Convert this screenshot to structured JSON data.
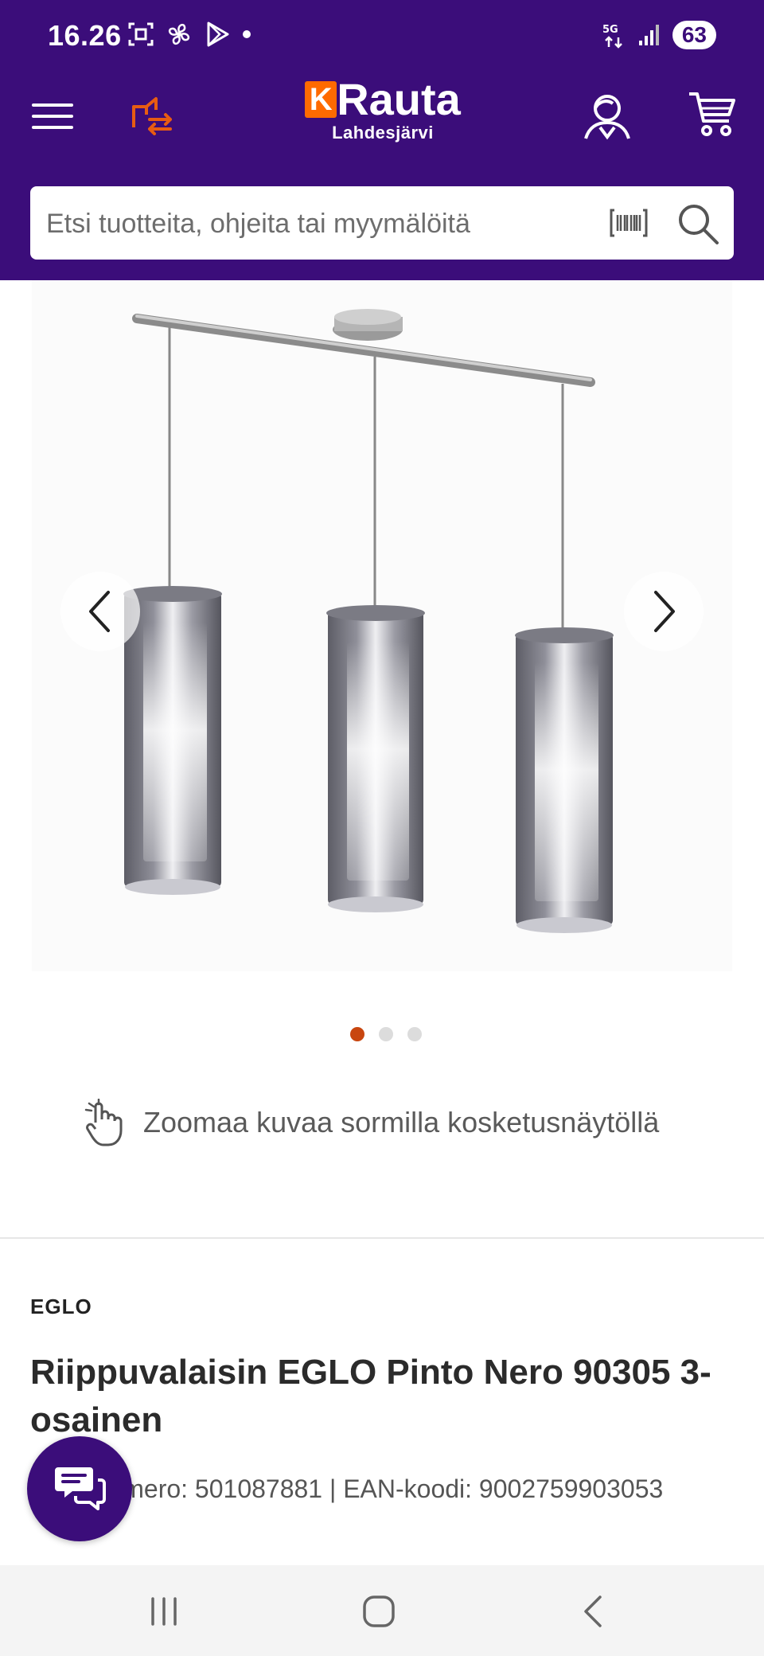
{
  "status_bar": {
    "time": "16.26",
    "network": "5G",
    "battery": "63"
  },
  "header": {
    "logo_letter": "K",
    "logo_word": "Rauta",
    "store_name": "Lahdesjärvi",
    "colors": {
      "background": "#3b0d7a",
      "accent": "#ff6a00"
    }
  },
  "search": {
    "placeholder": "Etsi tuotteita, ohjeita tai myymälöitä"
  },
  "gallery": {
    "image_count": 3,
    "active_index": 1
  },
  "zoom_hint": {
    "text": "Zoomaa kuvaa sormilla kosketusnäytöllä"
  },
  "product": {
    "brand": "EGLO",
    "title": "Riippuvalaisin EGLO Pinto Nero 90305 3-osainen",
    "codes_line": "Tuotenumero: 501087881  |  EAN-koodi: 9002759903053"
  }
}
